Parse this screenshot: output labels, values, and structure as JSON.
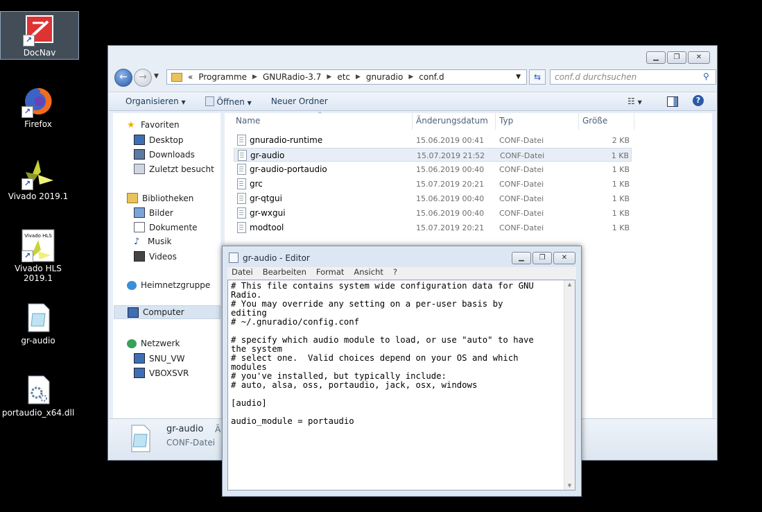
{
  "desktop": {
    "icons": [
      {
        "label": "DocNav",
        "icon": "docnav-icon",
        "selected": true
      },
      {
        "label": "Firefox",
        "icon": "firefox-icon"
      },
      {
        "label": "Vivado 2019.1",
        "icon": "vivado-icon"
      },
      {
        "label": "Vivado HLS 2019.1",
        "icon": "vivado-hls-icon"
      },
      {
        "label": "gr-audio",
        "icon": "conf-file-icon"
      },
      {
        "label": "portaudio_x64.dll",
        "icon": "dll-file-icon"
      }
    ]
  },
  "explorer": {
    "address": {
      "prefix": "«",
      "crumbs": [
        "Programme",
        "GNURadio-3.7",
        "etc",
        "gnuradio",
        "conf.d"
      ]
    },
    "search": {
      "placeholder": "conf.d durchsuchen"
    },
    "toolbar": {
      "organize": "Organisieren",
      "open": "Öffnen",
      "new_folder": "Neuer Ordner"
    },
    "sidebar": {
      "favorites": "Favoriten",
      "desktop": "Desktop",
      "downloads": "Downloads",
      "recent": "Zuletzt besucht",
      "libraries": "Bibliotheken",
      "pictures": "Bilder",
      "documents": "Dokumente",
      "music": "Musik",
      "videos": "Videos",
      "homegroup": "Heimnetzgruppe",
      "computer": "Computer",
      "network": "Netzwerk",
      "net1": "SNU_VW",
      "net2": "VBOXSVR"
    },
    "columns": {
      "name": "Name",
      "date": "Änderungsdatum",
      "type": "Typ",
      "size": "Größe"
    },
    "files": [
      {
        "name": "gnuradio-runtime",
        "date": "15.06.2019 00:41",
        "type": "CONF-Datei",
        "size": "2 KB"
      },
      {
        "name": "gr-audio",
        "date": "15.07.2019 21:52",
        "type": "CONF-Datei",
        "size": "1 KB"
      },
      {
        "name": "gr-audio-portaudio",
        "date": "15.06.2019 00:40",
        "type": "CONF-Datei",
        "size": "1 KB"
      },
      {
        "name": "grc",
        "date": "15.07.2019 20:21",
        "type": "CONF-Datei",
        "size": "1 KB"
      },
      {
        "name": "gr-qtgui",
        "date": "15.06.2019 00:40",
        "type": "CONF-Datei",
        "size": "1 KB"
      },
      {
        "name": "gr-wxgui",
        "date": "15.06.2019 00:40",
        "type": "CONF-Datei",
        "size": "1 KB"
      },
      {
        "name": "modtool",
        "date": "15.07.2019 20:21",
        "type": "CONF-Datei",
        "size": "1 KB"
      }
    ],
    "details": {
      "name": "gr-audio",
      "type": "CONF-Datei",
      "extra": "Ä"
    }
  },
  "editor": {
    "title": "gr-audio - Editor",
    "menu": [
      "Datei",
      "Bearbeiten",
      "Format",
      "Ansicht",
      "?"
    ],
    "content": "# This file contains system wide configuration data for GNU\nRadio.\n# You may override any setting on a per-user basis by\nediting\n# ~/.gnuradio/config.conf\n\n# specify which audio module to load, or use \"auto\" to have\nthe system\n# select one.  Valid choices depend on your OS and which\nmodules\n# you've installed, but typically include:\n# auto, alsa, oss, portaudio, jack, osx, windows\n\n[audio]\n\naudio_module = portaudio"
  }
}
